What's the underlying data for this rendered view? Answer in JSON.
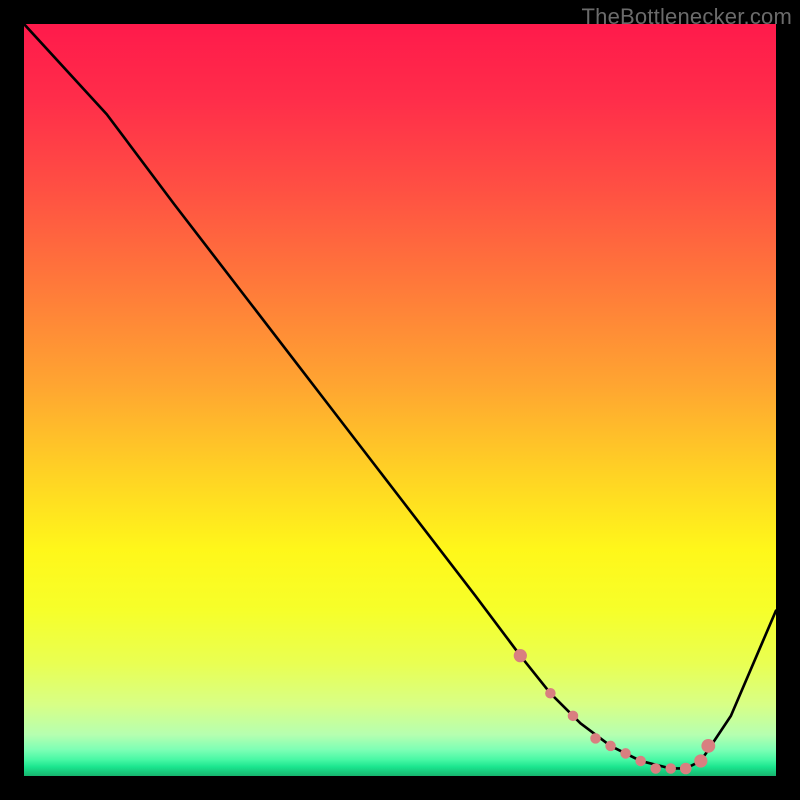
{
  "watermark": "TheBottlenecker.com",
  "colors": {
    "bg": "#000000",
    "curve": "#000000",
    "marker": "#d97f80",
    "gradient_stops": [
      {
        "offset": 0.0,
        "color": "#ff1a4b"
      },
      {
        "offset": 0.1,
        "color": "#ff2d4a"
      },
      {
        "offset": 0.22,
        "color": "#ff5043"
      },
      {
        "offset": 0.35,
        "color": "#ff7a3a"
      },
      {
        "offset": 0.48,
        "color": "#ffa531"
      },
      {
        "offset": 0.6,
        "color": "#ffd324"
      },
      {
        "offset": 0.7,
        "color": "#fff71a"
      },
      {
        "offset": 0.78,
        "color": "#f6ff2a"
      },
      {
        "offset": 0.85,
        "color": "#e9ff52"
      },
      {
        "offset": 0.905,
        "color": "#d8ff86"
      },
      {
        "offset": 0.945,
        "color": "#b6ffb0"
      },
      {
        "offset": 0.965,
        "color": "#7dffb5"
      },
      {
        "offset": 0.978,
        "color": "#49f8a5"
      },
      {
        "offset": 0.988,
        "color": "#1ae58e"
      },
      {
        "offset": 1.0,
        "color": "#17b46e"
      }
    ]
  },
  "chart_data": {
    "type": "line",
    "title": "",
    "xlabel": "",
    "ylabel": "",
    "xlim": [
      0,
      100
    ],
    "ylim": [
      0,
      100
    ],
    "series": [
      {
        "name": "curve",
        "x": [
          0,
          11,
          20,
          30,
          40,
          50,
          60,
          66,
          70,
          74,
          78,
          82,
          86,
          88,
          90,
          94,
          100
        ],
        "y": [
          100,
          88,
          76,
          63,
          50,
          37,
          24,
          16,
          11,
          7,
          4,
          2,
          1,
          1,
          2,
          8,
          22
        ]
      }
    ],
    "markers": {
      "name": "highlight-points",
      "x": [
        66,
        70,
        73,
        76,
        78,
        80,
        82,
        84,
        86,
        88,
        90,
        91
      ],
      "y": [
        16,
        11,
        8,
        5,
        4,
        3,
        2,
        1,
        1,
        1,
        2,
        4
      ],
      "r": [
        4.0,
        3.2,
        3.2,
        3.2,
        3.2,
        3.2,
        3.2,
        3.2,
        3.2,
        3.5,
        4.0,
        4.2
      ]
    }
  }
}
